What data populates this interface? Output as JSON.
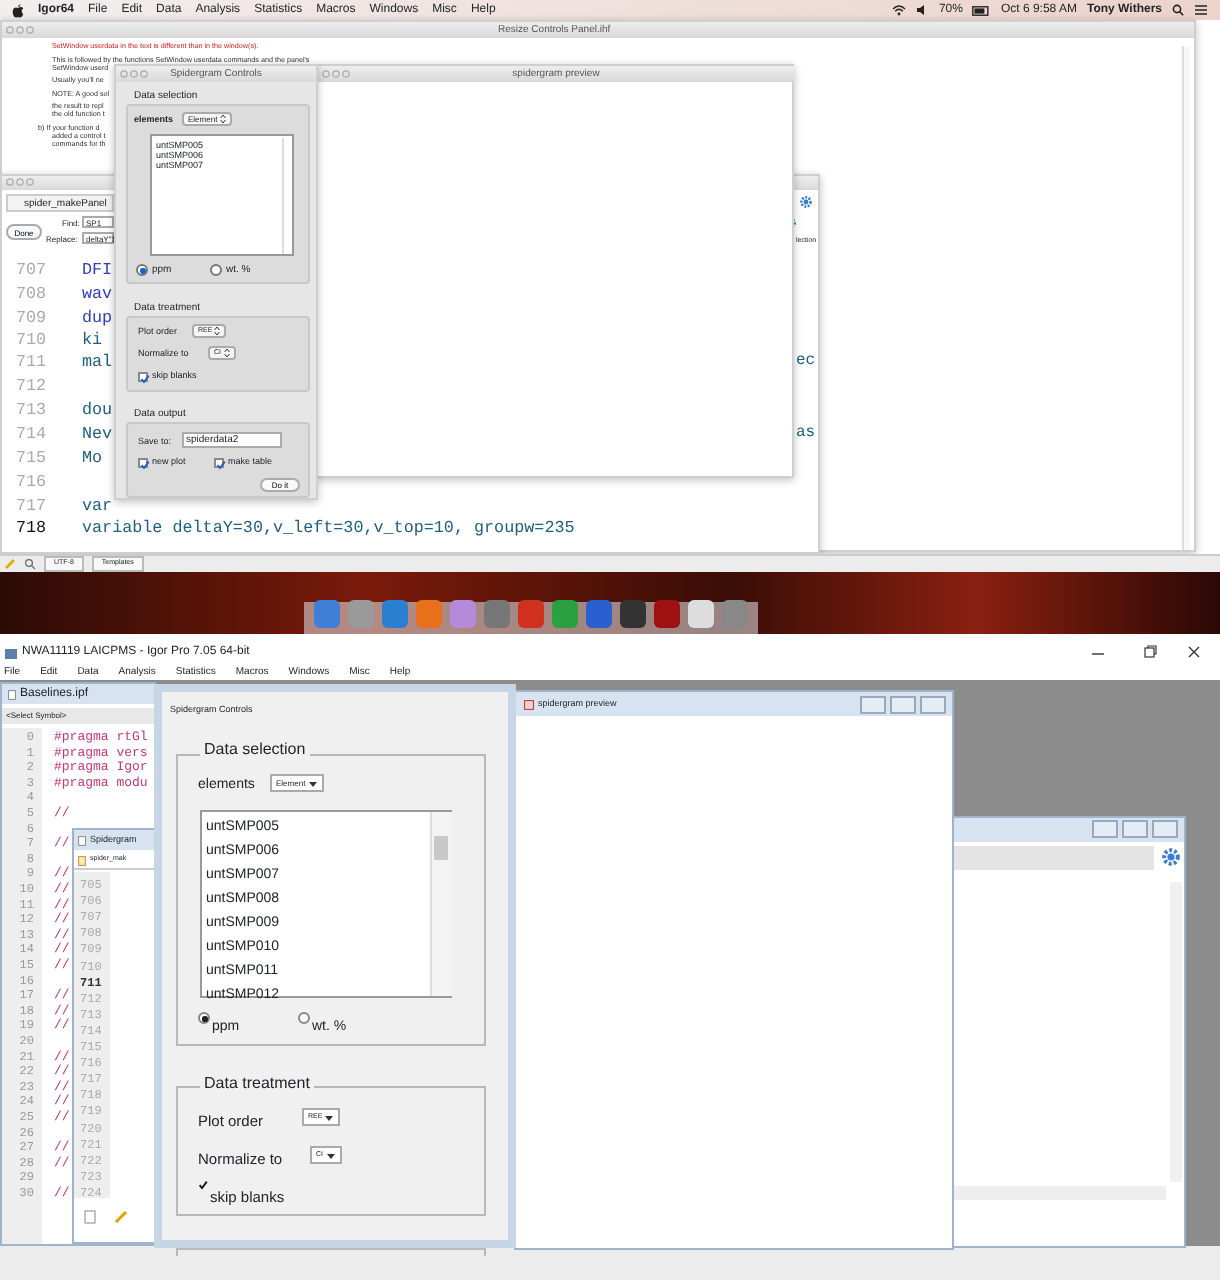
{
  "mac": {
    "menu_bar": {
      "items": [
        "Igor64",
        "File",
        "Edit",
        "Data",
        "Analysis",
        "Statistics",
        "Macros",
        "Windows",
        "Misc",
        "Help"
      ],
      "status": [
        "70%",
        "Oct 6  9:58 AM",
        "Tony Withers"
      ]
    },
    "notebook": {
      "title": "Resize Controls Panel.ihf",
      "lines": [
        {
          "text": "SetWindow userdata in the text is different than in the window(s).",
          "kind": "warning"
        },
        {
          "text": "This is followed by the functions SetWindow userdata commands and the panel's",
          "kind": "body"
        },
        {
          "text": "SetWindow userd",
          "kind": "body"
        },
        {
          "text": "Usually you'll ne",
          "kind": "gap"
        },
        {
          "text": "NOTE: A good sol",
          "kind": "gap"
        },
        {
          "text": "the result to repl",
          "kind": "body"
        },
        {
          "text": "the old function t",
          "kind": "body"
        },
        {
          "text": "b) If your function d",
          "kind": "item"
        },
        {
          "text": "added a control t",
          "kind": "body"
        },
        {
          "text": "commands for th",
          "kind": "body"
        }
      ]
    },
    "controls": {
      "title": "Spidergram Controls",
      "selection": {
        "title": "Data selection",
        "elements_label": "elements",
        "elements_value": "Element",
        "list": [
          "untSMP005",
          "untSMP006",
          "untSMP007"
        ],
        "units": [
          {
            "label": "ppm",
            "selected": true
          },
          {
            "label": "wt. %",
            "selected": false
          }
        ]
      },
      "treatment": {
        "title": "Data treatment",
        "plot_order_label": "Plot order",
        "plot_order_value": "REE",
        "normalize_label": "Normalize to",
        "normalize_value": "CI",
        "skip_blanks": {
          "label": "skip blanks",
          "checked": true
        }
      },
      "output": {
        "title": "Data output",
        "save_label": "Save to:",
        "save_value": "spiderdata2",
        "options": [
          {
            "label": "new plot",
            "checked": true
          },
          {
            "label": "make table",
            "checked": true
          }
        ],
        "button": "Do it"
      }
    },
    "preview": {
      "title": "spidergram preview"
    },
    "procedure": {
      "title": "spider_makePanel",
      "done": "Done",
      "find_label": "Find:",
      "find_value": "SP1",
      "replace_label": "Replace:",
      "replace_value": "deltaY\"1",
      "side_tab": "lection",
      "code": [
        {
          "number": "707",
          "text": "DFI",
          "current": false
        },
        {
          "number": "708",
          "text": "wav",
          "current": false
        },
        {
          "number": "709",
          "text": "dup",
          "current": false
        },
        {
          "number": "710",
          "text": "ki",
          "current": false
        },
        {
          "number": "711",
          "text": "mal",
          "tail": "ec",
          "current": false
        },
        {
          "number": "712",
          "current": false
        },
        {
          "number": "713",
          "text": "dou",
          "current": false
        },
        {
          "number": "714",
          "text": "Nev",
          "tail": "as",
          "current": false
        },
        {
          "number": "715",
          "text": "Mo",
          "current": false
        },
        {
          "number": "716",
          "current": false
        },
        {
          "number": "717",
          "text": "var",
          "current": false
        },
        {
          "number": "718",
          "text": "variable deltaY=30,v_left=30,v_top=10, groupw=235",
          "current": true
        }
      ]
    },
    "toolbar": [
      "UTF-8",
      "Templates"
    ]
  },
  "win": {
    "title": "NWA11119 LAICPMS - Igor Pro 7.05 64-bit",
    "menu": [
      "File",
      "Edit",
      "Data",
      "Analysis",
      "Statistics",
      "Macros",
      "Windows",
      "Misc",
      "Help"
    ],
    "baselines": {
      "title": "Baselines.ipf",
      "symbol": "<Select Symbol>",
      "lines": [
        {
          "number": "0",
          "text": "#pragma rtGl"
        },
        {
          "number": "1",
          "text": "#pragma vers"
        },
        {
          "number": "2",
          "text": "#pragma Igor"
        },
        {
          "number": "3",
          "text": "#pragma modu"
        },
        {
          "number": "4"
        },
        {
          "number": "5",
          "text": "//"
        },
        {
          "number": "6"
        },
        {
          "number": "7",
          "text": "//"
        },
        {
          "number": "8"
        },
        {
          "number": "9",
          "text": "//"
        },
        {
          "number": "10",
          "text": "//"
        },
        {
          "number": "11",
          "text": "//"
        },
        {
          "number": "12",
          "text": "//"
        },
        {
          "number": "13",
          "text": "//"
        },
        {
          "number": "14",
          "text": "//"
        },
        {
          "number": "15",
          "text": "//"
        },
        {
          "number": "16"
        },
        {
          "number": "17",
          "text": "//"
        },
        {
          "number": "18",
          "text": "//"
        },
        {
          "number": "19",
          "text": "//"
        },
        {
          "number": "20"
        },
        {
          "number": "21",
          "text": "//"
        },
        {
          "number": "22",
          "text": "//"
        },
        {
          "number": "23",
          "text": "//"
        },
        {
          "number": "24",
          "text": "//"
        },
        {
          "number": "25",
          "text": "//"
        },
        {
          "number": "26"
        },
        {
          "number": "27",
          "text": "//"
        },
        {
          "number": "28",
          "text": "//"
        },
        {
          "number": "29"
        },
        {
          "number": "30",
          "text": "//"
        }
      ]
    },
    "spidergram": {
      "title": "Spidergram",
      "tab": "spider_mak",
      "numbers": [
        {
          "number": "705",
          "current": false
        },
        {
          "number": "706",
          "current": false
        },
        {
          "number": "707",
          "current": false
        },
        {
          "number": "708",
          "current": false
        },
        {
          "number": "709",
          "current": false
        },
        {
          "number": "710",
          "current": false
        },
        {
          "number": "711",
          "current": true
        },
        {
          "number": "712",
          "current": false
        },
        {
          "number": "713",
          "current": false
        },
        {
          "number": "714",
          "current": false
        },
        {
          "number": "715",
          "current": false
        },
        {
          "number": "716",
          "current": false
        },
        {
          "number": "717",
          "current": false
        },
        {
          "number": "718",
          "current": false
        },
        {
          "number": "719",
          "current": false
        },
        {
          "number": "720",
          "current": false
        },
        {
          "number": "721",
          "current": false
        },
        {
          "number": "722",
          "current": false
        },
        {
          "number": "723",
          "current": false
        },
        {
          "number": "724",
          "current": false
        }
      ]
    },
    "controls": {
      "title": "Spidergram Controls",
      "selection": {
        "title": "Data selection",
        "elements_label": "elements",
        "elements_value": "Element",
        "list": [
          "untSMP005",
          "untSMP006",
          "untSMP007",
          "untSMP008",
          "untSMP009",
          "untSMP010",
          "untSMP011",
          "untSMP012"
        ],
        "units": [
          {
            "label": "ppm",
            "selected": true
          },
          {
            "label": "wt. %",
            "selected": false
          }
        ]
      },
      "treatment": {
        "title": "Data treatment",
        "plot_order_label": "Plot order",
        "plot_order_value": "REE",
        "normalize_label": "Normalize to",
        "normalize_value": "CI",
        "skip_blanks": {
          "label": "skip blanks",
          "checked": true
        }
      }
    },
    "preview": {
      "title": "spidergram preview"
    }
  }
}
